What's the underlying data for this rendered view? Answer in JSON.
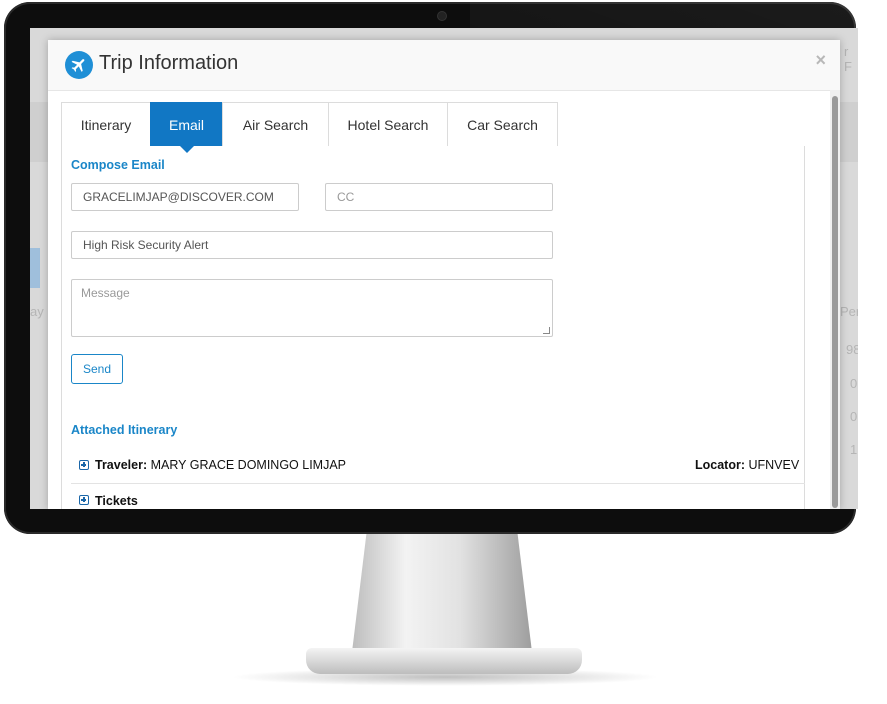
{
  "modal": {
    "title": "Trip Information",
    "close_symbol": "×",
    "icon": "airplane-icon"
  },
  "tabs": [
    {
      "label": "Itinerary",
      "active": false
    },
    {
      "label": "Email",
      "active": true
    },
    {
      "label": "Air Search",
      "active": false
    },
    {
      "label": "Hotel Search",
      "active": false
    },
    {
      "label": "Car Search",
      "active": false
    }
  ],
  "compose": {
    "title": "Compose Email",
    "to_value": "GRACELIMJAP@DISCOVER.COM",
    "cc_placeholder": "CC",
    "subject_value": "High Risk Security Alert",
    "message_placeholder": "Message",
    "send_label": "Send"
  },
  "attached": {
    "title": "Attached Itinerary",
    "traveler_label": "Traveler:",
    "traveler_value": "MARY GRACE DOMINGO LIMJAP",
    "locator_label": "Locator:",
    "locator_value": "UFNVEV",
    "tickets_label": "Tickets"
  },
  "background": {
    "right_values": [
      "98",
      "0",
      "0",
      "1"
    ],
    "right_header": "Per",
    "left_fragment": "ay",
    "top_right_fragment": "r F"
  },
  "colors": {
    "accent": "#1177c4",
    "link": "#1a86c8",
    "plane_badge": "#1f8fd6"
  }
}
